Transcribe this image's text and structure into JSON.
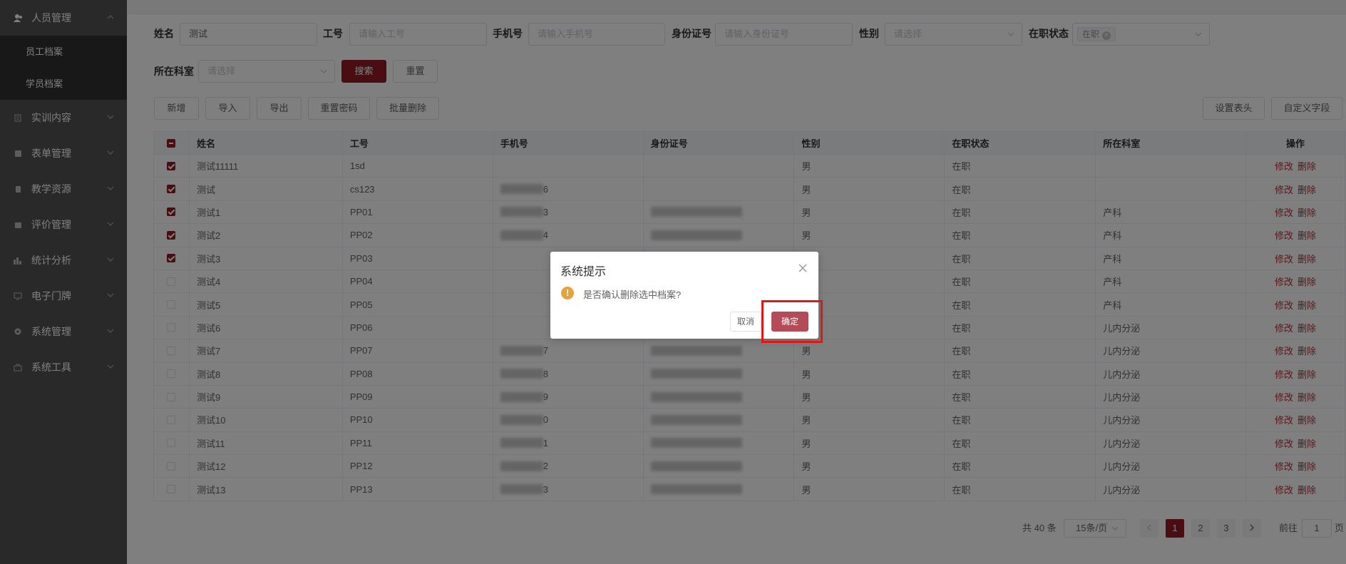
{
  "sidebar": {
    "groups": [
      {
        "label": "人员管理",
        "icon": "user-icon",
        "expanded": true
      },
      {
        "label": "实训内容",
        "icon": "clipboard-icon"
      },
      {
        "label": "表单管理",
        "icon": "form-icon"
      },
      {
        "label": "教学资源",
        "icon": "book-icon"
      },
      {
        "label": "评价管理",
        "icon": "evaluation-icon"
      },
      {
        "label": "统计分析",
        "icon": "bar-chart-icon"
      },
      {
        "label": "电子门牌",
        "icon": "monitor-icon"
      },
      {
        "label": "系统管理",
        "icon": "gear-icon"
      },
      {
        "label": "系统工具",
        "icon": "toolbox-icon"
      }
    ],
    "sub_items": [
      {
        "label": "员工档案",
        "active": true
      },
      {
        "label": "学员档案"
      }
    ]
  },
  "filters": {
    "name_label": "姓名",
    "name_value": "测试",
    "job_no_label": "工号",
    "job_no_placeholder": "请输入工号",
    "phone_label": "手机号",
    "phone_placeholder": "请输入手机号",
    "id_label": "身份证号",
    "id_placeholder": "请输入身份证号",
    "gender_label": "性别",
    "gender_placeholder": "请选择",
    "status_label": "在职状态",
    "status_tag": "在职",
    "dept_label": "所在科室",
    "dept_placeholder": "请选择",
    "search_label": "搜索",
    "reset_label": "重置"
  },
  "toolbar": {
    "add": "新增",
    "import": "导入",
    "export": "导出",
    "reset_pwd": "重置密码",
    "batch_delete": "批量删除",
    "set_header": "设置表头",
    "custom_field": "自定义字段"
  },
  "table": {
    "headers": [
      "姓名",
      "工号",
      "手机号",
      "身份证号",
      "性别",
      "在职状态",
      "所在科室",
      "操作"
    ],
    "edit_label": "修改",
    "delete_label": "删除",
    "rows": [
      {
        "checked": true,
        "name": "测试11111",
        "job_no": "1sd",
        "phone_tail": "",
        "has_id": false,
        "gender": "男",
        "status": "在职",
        "dept": ""
      },
      {
        "checked": true,
        "name": "测试",
        "job_no": "cs123",
        "phone_tail": "6",
        "has_id": false,
        "gender": "男",
        "status": "在职",
        "dept": ""
      },
      {
        "checked": true,
        "name": "测试1",
        "job_no": "PP01",
        "phone_tail": "3",
        "has_id": true,
        "gender": "男",
        "status": "在职",
        "dept": "产科"
      },
      {
        "checked": true,
        "name": "测试2",
        "job_no": "PP02",
        "phone_tail": "4",
        "has_id": true,
        "gender": "男",
        "status": "在职",
        "dept": "产科"
      },
      {
        "checked": true,
        "name": "测试3",
        "job_no": "PP03",
        "phone_tail": "",
        "has_id": false,
        "gender": "",
        "status": "在职",
        "dept": "产科"
      },
      {
        "checked": false,
        "name": "测试4",
        "job_no": "PP04",
        "phone_tail": "",
        "has_id": false,
        "gender": "",
        "status": "在职",
        "dept": "产科"
      },
      {
        "checked": false,
        "name": "测试5",
        "job_no": "PP05",
        "phone_tail": "",
        "has_id": false,
        "gender": "",
        "status": "在职",
        "dept": "产科"
      },
      {
        "checked": false,
        "name": "测试6",
        "job_no": "PP06",
        "phone_tail": "",
        "has_id": false,
        "gender": "",
        "status": "在职",
        "dept": "儿内分泌"
      },
      {
        "checked": false,
        "name": "测试7",
        "job_no": "PP07",
        "phone_tail": "7",
        "has_id": true,
        "gender": "男",
        "status": "在职",
        "dept": "儿内分泌"
      },
      {
        "checked": false,
        "name": "测试8",
        "job_no": "PP08",
        "phone_tail": "8",
        "has_id": true,
        "gender": "男",
        "status": "在职",
        "dept": "儿内分泌"
      },
      {
        "checked": false,
        "name": "测试9",
        "job_no": "PP09",
        "phone_tail": "9",
        "has_id": true,
        "gender": "男",
        "status": "在职",
        "dept": "儿内分泌"
      },
      {
        "checked": false,
        "name": "测试10",
        "job_no": "PP10",
        "phone_tail": "0",
        "has_id": true,
        "gender": "男",
        "status": "在职",
        "dept": "儿内分泌"
      },
      {
        "checked": false,
        "name": "测试11",
        "job_no": "PP11",
        "phone_tail": "1",
        "has_id": true,
        "gender": "男",
        "status": "在职",
        "dept": "儿内分泌"
      },
      {
        "checked": false,
        "name": "测试12",
        "job_no": "PP12",
        "phone_tail": "2",
        "has_id": true,
        "gender": "男",
        "status": "在职",
        "dept": "儿内分泌"
      },
      {
        "checked": false,
        "name": "测试13",
        "job_no": "PP13",
        "phone_tail": "3",
        "has_id": true,
        "gender": "男",
        "status": "在职",
        "dept": "儿内分泌"
      }
    ]
  },
  "pagination": {
    "total": "共 40 条",
    "page_size": "15条/页",
    "pages": [
      "1",
      "2",
      "3"
    ],
    "current": "1",
    "goto_label": "前往",
    "goto_value": "1",
    "page_unit": "页"
  },
  "dialog": {
    "title": "系统提示",
    "message": "是否确认删除选中档案?",
    "cancel": "取消",
    "confirm": "确定"
  },
  "colors": {
    "primary": "#931b25",
    "dialog_confirm": "#b54b57",
    "highlight": "#e0161b",
    "sidebar_bg": "#535353"
  }
}
